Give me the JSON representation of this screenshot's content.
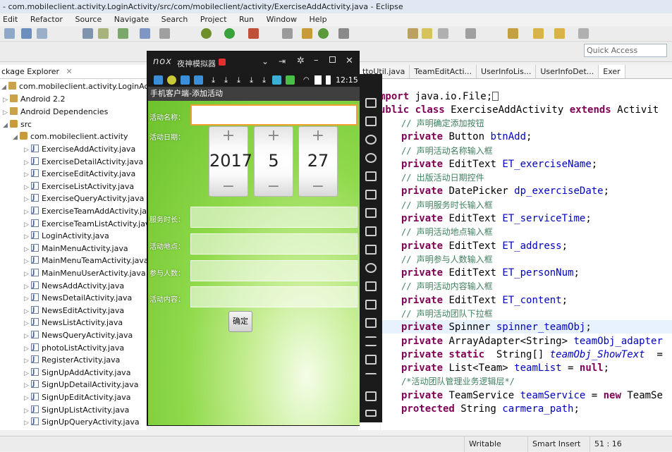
{
  "window": {
    "title": "- com.mobileclient.activity.LoginActivity/src/com/mobileclient/activity/ExerciseAddActivity.java - Eclipse"
  },
  "menu": [
    "Edit",
    "Refactor",
    "Source",
    "Navigate",
    "Search",
    "Project",
    "Run",
    "Window",
    "Help"
  ],
  "quick_access": {
    "placeholder": "Quick Access"
  },
  "package_explorer": {
    "tab_label": "ckage Explorer",
    "project": "com.mobileclient.activity.LoginActivity",
    "android_lib": "Android 2.2",
    "android_deps": "Android Dependencies",
    "src": "src",
    "package": "com.mobileclient.activity",
    "files": [
      "ExerciseAddActivity.java",
      "ExerciseDetailActivity.java",
      "ExerciseEditActivity.java",
      "ExerciseListActivity.java",
      "ExerciseQueryActivity.java",
      "ExerciseTeamAddActivity.java",
      "ExerciseTeamListActivity.java",
      "LoginActivity.java",
      "MainMenuActivity.java",
      "MainMenuTeamActivity.java",
      "MainMenuUserActivity.java",
      "NewsAddActivity.java",
      "NewsDetailActivity.java",
      "NewsEditActivity.java",
      "NewsListActivity.java",
      "NewsQueryActivity.java",
      "photoListActivity.java",
      "RegisterActivity.java",
      "SignUpAddActivity.java",
      "SignUpDetailActivity.java",
      "SignUpEditActivity.java",
      "SignUpListActivity.java",
      "SignUpQueryActivity.java"
    ]
  },
  "editor_tabs": [
    "ttoUtil.java",
    "TeamEditActi...",
    "UserInfoLis...",
    "UserInfoDet...",
    "Exer"
  ],
  "code": {
    "l1_kw": "mport",
    "l1_rest": " java.io.File;",
    "l2_kw1": "ublic class",
    "l2_mid": " ExerciseAddActivity ",
    "l2_kw2": "extends",
    "l2_end": " Activit",
    "c1": "// 声明确定添加按钮",
    "l3_kw": "private",
    "l3_type": " Button ",
    "l3_field": "btnAdd",
    "l3_end": ";",
    "c2": "// 声明活动名称输入框",
    "l4_kw": "private",
    "l4_type": " EditText ",
    "l4_field": "ET_exerciseName",
    "l4_end": ";",
    "c3": "// 出版活动日期控件",
    "l5_kw": "private",
    "l5_type": " DatePicker ",
    "l5_field": "dp_exerciseDate",
    "l5_end": ";",
    "c4": "// 声明服务时长输入框",
    "l6_kw": "private",
    "l6_type": " EditText ",
    "l6_field": "ET_serviceTime",
    "l6_end": ";",
    "c5": "// 声明活动地点输入框",
    "l7_kw": "private",
    "l7_type": " EditText ",
    "l7_field": "ET_address",
    "l7_end": ";",
    "c6": "// 声明参与人数输入框",
    "l8_kw": "private",
    "l8_type": " EditText ",
    "l8_field": "ET_personNum",
    "l8_end": ";",
    "c7": "// 声明活动内容输入框",
    "l9_kw": "private",
    "l9_type": " EditText ",
    "l9_field": "ET_content",
    "l9_end": ";",
    "c8": "// 声明活动团队下拉框",
    "l10_kw": "private",
    "l10_type": " Spinner ",
    "l10_field": "spinner_teamObj",
    "l10_end": ";",
    "l11_kw": "private",
    "l11_type": " ArrayAdapter<String> ",
    "l11_field": "teamObj_adapter",
    "l12_kw": "private static",
    "l12_type": "  String[] ",
    "l12_field": "teamObj_ShowText",
    "l12_end": "  =",
    "l13_kw": "private",
    "l13_type": " List<Team> ",
    "l13_field": "teamList",
    "l13_mid": " = ",
    "l13_kw2": "null",
    "l13_end": ";",
    "c9": "/*活动团队管理业务逻辑层*/",
    "l14_kw": "private",
    "l14_type": " TeamService ",
    "l14_field": "teamService",
    "l14_mid": " = ",
    "l14_kw2": "new",
    "l14_end": " TeamSe",
    "l15_kw": "protected",
    "l15_type": " String ",
    "l15_field": "carmera_path",
    "l15_end": ";"
  },
  "emulator": {
    "brand": "nox",
    "name": "夜神模拟器",
    "time": "12:15",
    "app_title": "手机客户端-添加活动",
    "labels": {
      "name": "活动名称：",
      "date": "活动日期：",
      "service": "服务时长：",
      "address": "活动地点：",
      "persons": "参与人数：",
      "content": "活动内容："
    },
    "date": {
      "year": "2017",
      "month": "5",
      "day": "27",
      "plus": "+",
      "minus": "−"
    },
    "submit": "确定"
  },
  "status": {
    "mode": "Writable",
    "insert": "Smart Insert",
    "position": "51 : 16"
  }
}
